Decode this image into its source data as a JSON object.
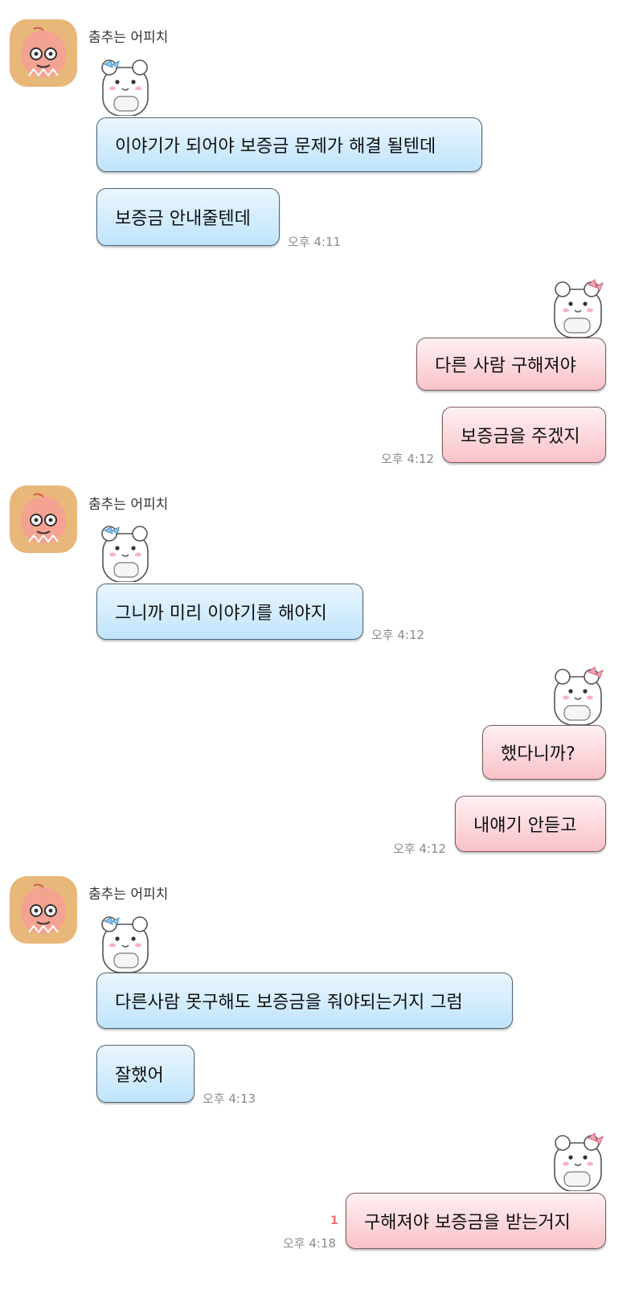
{
  "colors": {
    "incoming_bubble": "#bfe4fb",
    "outgoing_bubble": "#f9c2c8",
    "unread": "#f06a6a",
    "time": "#8a8a8a"
  },
  "groups": [
    {
      "sender": "춤추는 어피치",
      "messages": [
        "이야기가 되어야 보증금 문제가 해결 될텐데",
        "보증금 안내줄텐데"
      ],
      "time": "오후 4:11"
    },
    {
      "messages": [
        "다른 사람 구해져야",
        "보증금을 주겠지"
      ],
      "time": "오후 4:12"
    },
    {
      "sender": "춤추는 어피치",
      "messages": [
        "그니까 미리 이야기를 해야지"
      ],
      "time": "오후 4:12"
    },
    {
      "messages": [
        "했다니까?",
        "내얘기 안듣고"
      ],
      "time": "오후 4:12"
    },
    {
      "sender": "춤추는 어피치",
      "messages": [
        "다른사람 못구해도 보증금을 줘야되는거지 그럼",
        "잘했어"
      ],
      "time": "오후 4:13"
    },
    {
      "messages": [
        "구해져야 보증금을 받는거지"
      ],
      "time": "오후 4:18",
      "unread": "1"
    }
  ],
  "icons": {
    "avatar": "apeach-avatar-icon",
    "sticker_in": "bear-sticker-icon",
    "sticker_out": "cat-sticker-icon"
  }
}
